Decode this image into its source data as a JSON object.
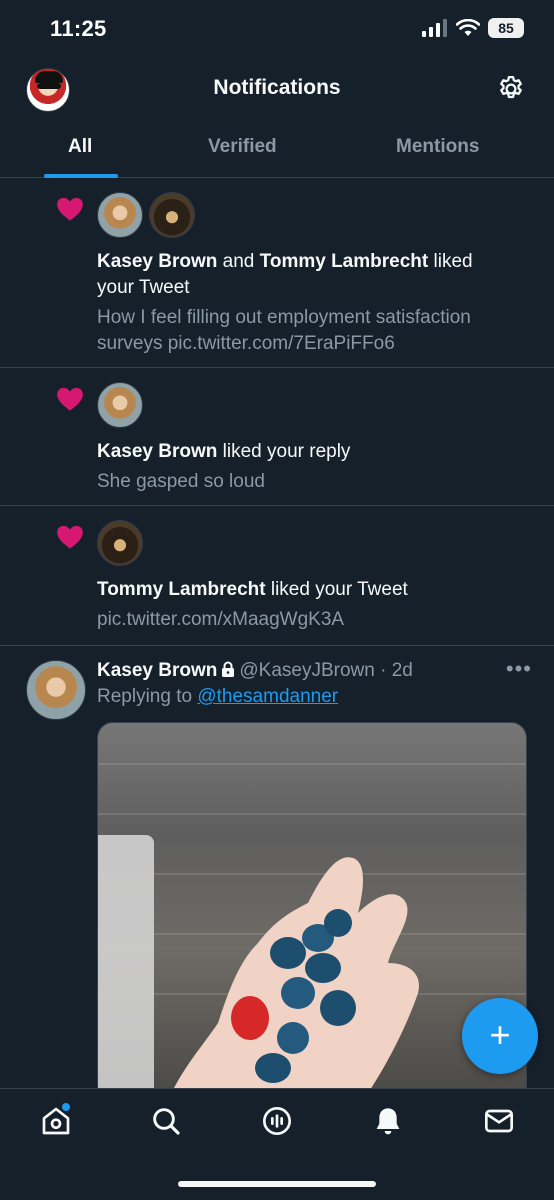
{
  "status_bar": {
    "time": "11:25",
    "battery": "85"
  },
  "header": {
    "title": "Notifications"
  },
  "tabs": [
    {
      "label": "All",
      "active": true
    },
    {
      "label": "Verified",
      "active": false
    },
    {
      "label": "Mentions",
      "active": false
    }
  ],
  "notifications": [
    {
      "actor1": "Kasey Brown",
      "connector": " and ",
      "actor2": "Tommy Lambrecht",
      "action": " liked your Tweet",
      "snippet": "How I feel filling out employment satisfaction surveys pic.twitter.com/7EraPiFFo6"
    },
    {
      "actor1": "Kasey Brown",
      "action": " liked your reply",
      "snippet": "She gasped so loud"
    },
    {
      "actor1": "Tommy Lambrecht",
      "action": " liked your Tweet",
      "snippet": "pic.twitter.com/xMaagWgK3A"
    }
  ],
  "tweet": {
    "name": "Kasey Brown",
    "handle": "@KaseyJBrown",
    "separator": " · ",
    "time": "2d",
    "more": "•••",
    "replying_prefix": "Replying to ",
    "replying_to": "@thesamdanner"
  },
  "fab": {
    "label": "+"
  },
  "colors": {
    "accent": "#1d9bf0",
    "heart": "#f91880",
    "background": "#15202b"
  }
}
